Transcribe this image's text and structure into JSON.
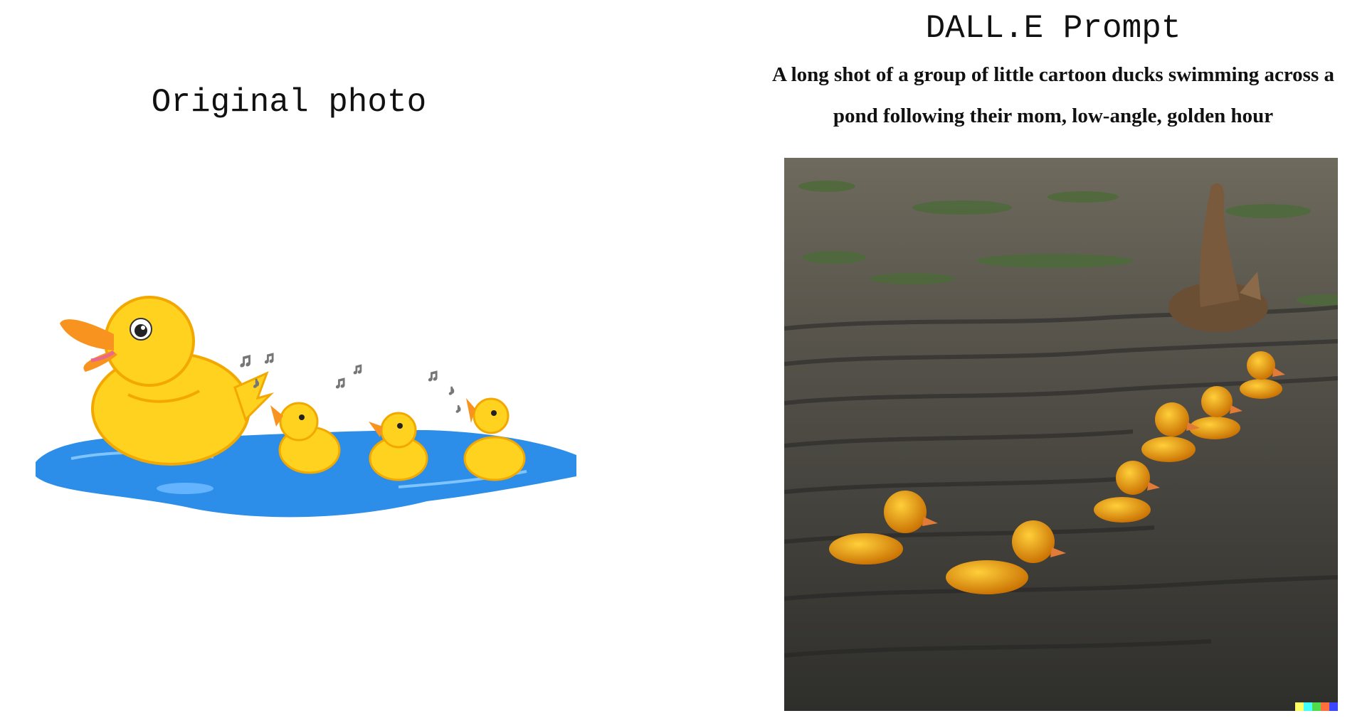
{
  "left": {
    "title": "Original photo"
  },
  "right": {
    "title": "DALL.E Prompt",
    "prompt": "A long shot of a group of little cartoon ducks swimming across a pond following their mom, low-angle, golden hour"
  },
  "colors": {
    "pond_blue": "#2c8ee8",
    "duck_yellow": "#ffd21f",
    "beak_orange": "#f7931e",
    "water_dark": "#3b3a34",
    "mom_duck_brown": "#6b4f35"
  }
}
